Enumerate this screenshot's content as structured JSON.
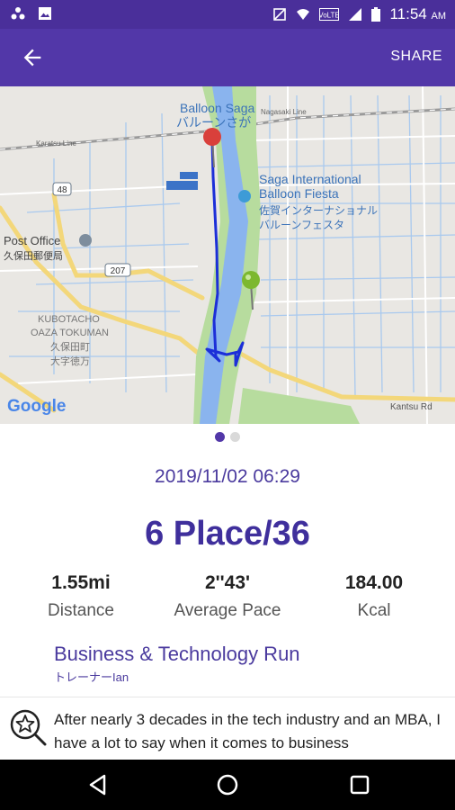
{
  "status_bar": {
    "time": "11:54",
    "am_pm": "AM",
    "icons": [
      "dots-icon",
      "image-icon",
      "mute-icon",
      "wifi-icon",
      "volte-icon",
      "signal-icon",
      "battery-icon"
    ]
  },
  "app_bar": {
    "back_icon": "arrow-left-icon",
    "share_label": "SHARE"
  },
  "map": {
    "labels": {
      "balloon_saga_en": "Balloon Saga",
      "balloon_saga_jp": "バルーンさが",
      "festival_en_1": "Saga International",
      "festival_en_2": "Balloon Fiesta",
      "festival_jp_1": "佐賀インターナショナル",
      "festival_jp_2": "バルーンフェスタ",
      "post_office_en": "Post Office",
      "post_office_jp": "久保田郵便局",
      "area_1": "KUBOTACHO",
      "area_2": "OAZA TOKUMAN",
      "area_jp_1": "久保田町",
      "area_jp_2": "大字徳万",
      "route_48": "48",
      "route_207": "207",
      "kantsu_rd": "Kantsu Rd",
      "karatsu_line": "Karatsu Line",
      "nagasaki_line": "Nagasaki Line",
      "google": "Google"
    },
    "start_color": "#7cb82f",
    "end_color": "#d9403b",
    "route_color": "#1c2fd8"
  },
  "pager": {
    "count": 2,
    "active": 0
  },
  "run": {
    "datetime": "2019/11/02 06:29",
    "place": "6 Place/36",
    "stats": [
      {
        "value": "1.55mi",
        "label": "Distance"
      },
      {
        "value": "2''43'",
        "label": "Average Pace"
      },
      {
        "value": "184.00",
        "label": "Kcal"
      }
    ],
    "course_title": "Business & Technology Run",
    "trainer": "トレーナーIan",
    "description": "After nearly 3 decades in the tech industry and an MBA, I have a lot to say when it comes to business"
  },
  "colors": {
    "accent": "#5237a8",
    "status_bar": "#4a2f9a"
  }
}
